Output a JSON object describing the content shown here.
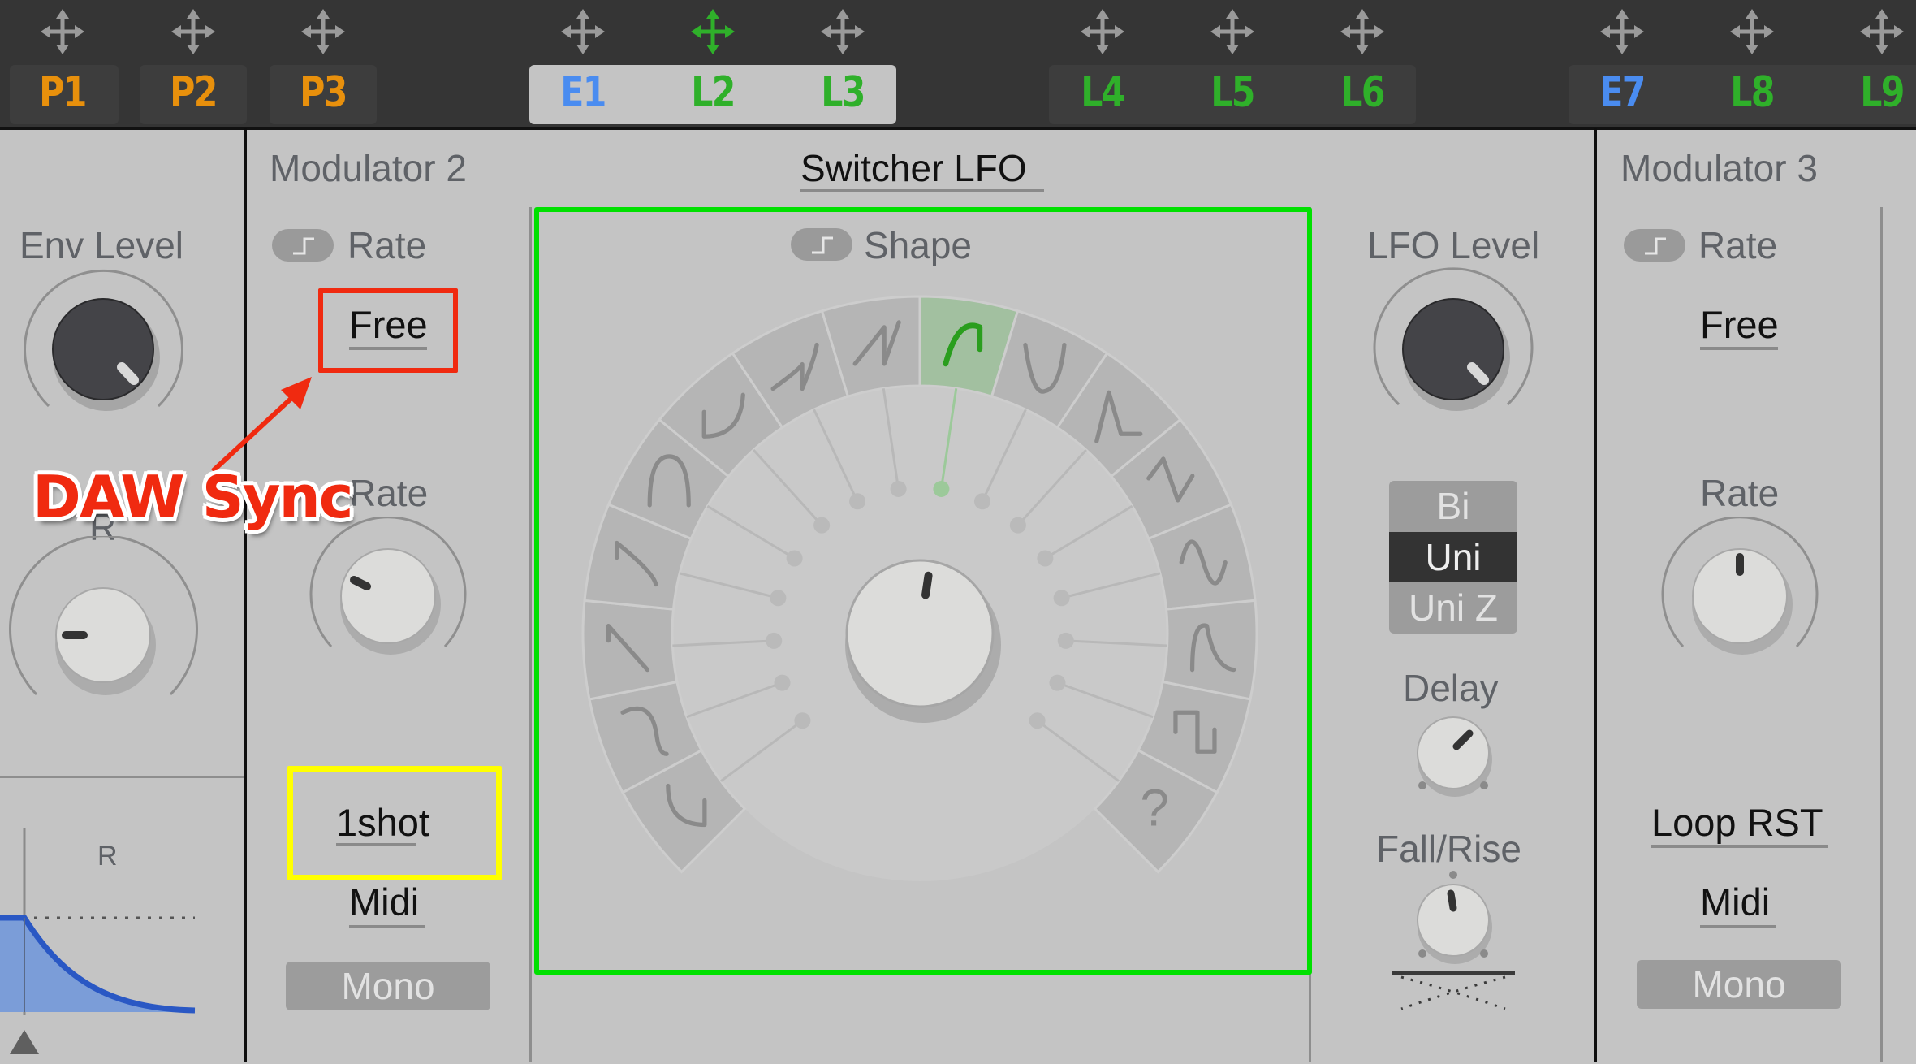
{
  "top_bar": {
    "macros": [
      {
        "label": "P1",
        "color": "#e8900c",
        "move_icon_color": "#9a9a9a"
      },
      {
        "label": "P2",
        "color": "#e8900c",
        "move_icon_color": "#9a9a9a"
      },
      {
        "label": "P3",
        "color": "#e8900c",
        "move_icon_color": "#9a9a9a"
      },
      {
        "label": "E1",
        "color": "#4a8cf0",
        "move_icon_color": "#9a9a9a"
      },
      {
        "label": "L2",
        "color": "#2fb02a",
        "move_icon_color": "#2fb02a"
      },
      {
        "label": "L3",
        "color": "#2fb02a",
        "move_icon_color": "#9a9a9a"
      },
      {
        "label": "L4",
        "color": "#2fb02a",
        "move_icon_color": "#9a9a9a"
      },
      {
        "label": "L5",
        "color": "#2fb02a",
        "move_icon_color": "#9a9a9a"
      },
      {
        "label": "L6",
        "color": "#2fb02a",
        "move_icon_color": "#9a9a9a"
      },
      {
        "label": "E7",
        "color": "#4a8cf0",
        "move_icon_color": "#9a9a9a"
      },
      {
        "label": "L8",
        "color": "#2fb02a",
        "move_icon_color": "#9a9a9a"
      },
      {
        "label": "L9",
        "color": "#2fb02a",
        "move_icon_color": "#9a9a9a"
      }
    ],
    "active_group": [
      "E1",
      "L2",
      "L3"
    ]
  },
  "left_panel": {
    "env_level_label": "Env Level",
    "release_knob_label_partial": "R",
    "envelope_segment_label": "R"
  },
  "modulator2": {
    "title": "Modulator 2",
    "rate_toggle_label": "Rate",
    "rate_mode": "Free",
    "rate_knob_label": "Rate",
    "trigger_mode": "1shot",
    "trigger_source": "Midi",
    "voice_mode": "Mono"
  },
  "switcher_lfo": {
    "title": "Switcher LFO",
    "shape_toggle_label": "Shape",
    "shapes": [
      "hook-down",
      "s-curve-down",
      "ramp-down",
      "s-ramp",
      "arch",
      "exp-rise",
      "log-saw",
      "saw-up",
      "exp-saw",
      "bowl",
      "spike",
      "triangle-zigzag",
      "sine",
      "bump",
      "square",
      "random"
    ],
    "selected_shape_index": 8,
    "random_label": "?",
    "accent_color": "#2a9e1e"
  },
  "lfo_controls": {
    "lfo_level_label": "LFO Level",
    "polarity_options": [
      "Bi",
      "Uni",
      "Uni Z"
    ],
    "polarity_selected": "Uni",
    "delay_label": "Delay",
    "fall_rise_label": "Fall/Rise"
  },
  "modulator3": {
    "title": "Modulator 3",
    "rate_toggle_label": "Rate",
    "rate_mode": "Free",
    "rate_knob_label": "Rate",
    "trigger_mode": "Loop RST",
    "trigger_source": "Midi",
    "voice_mode": "Mono"
  },
  "annotations": {
    "callout_text": "DAW Sync",
    "callout_color": "#f02a10",
    "highlight_green": "#00e000",
    "highlight_yellow": "#ffff00",
    "highlight_red": "#f02a10"
  }
}
